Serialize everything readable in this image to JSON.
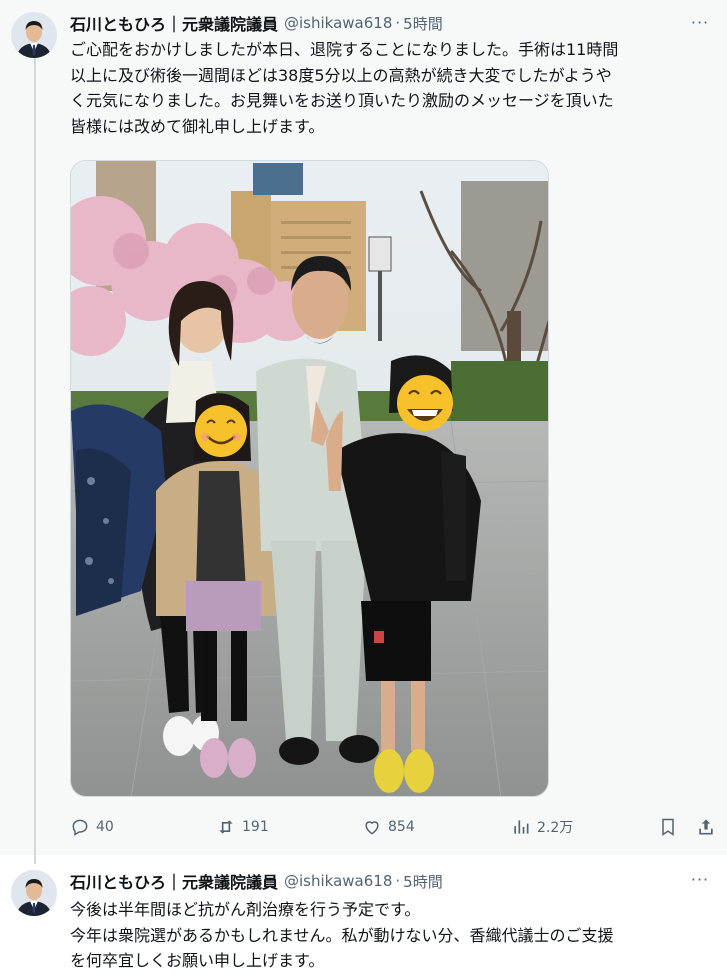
{
  "tweets": [
    {
      "author_name": "石川ともひろ｜元衆議院議員",
      "handle": "@ishikawa618",
      "separator": "·",
      "time": "5時間",
      "more": "···",
      "text": "ご心配をおかけしましたが本日、退院することになりました。手術は11時間\n以上に及び術後一週間ほどは38度5分以上の高熱が続き大変でしたがようや\nく元気になりました。お見舞いをお送り頂いたり激励のメッセージを頂いた\n皆様には改めて御礼申し上げます。",
      "actions": {
        "reply_icon": "reply-icon",
        "replies": "40",
        "retweet_icon": "retweet-icon",
        "retweets": "191",
        "like_icon": "heart-icon",
        "likes": "854",
        "views_icon": "views-icon",
        "views": "2.2万",
        "bookmark_icon": "bookmark-icon",
        "share_icon": "share-icon"
      }
    },
    {
      "author_name": "石川ともひろ｜元衆議院議員",
      "handle": "@ishikawa618",
      "separator": "·",
      "time": "5時間",
      "more": "···",
      "text": "今後は半年間ほど抗がん剤治療を行う予定です。\n今年は衆院選があるかもしれません。私が動けない分、香織代議士のご支援\nを何卒宜しくお願い申し上げます。"
    }
  ],
  "colors": {
    "secondary_text": "#536471",
    "thread_line": "#cfd9de",
    "highlight_bg": "#f7f9f9"
  }
}
